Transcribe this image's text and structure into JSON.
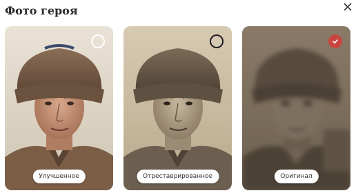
{
  "dialog": {
    "title": "Фото героя",
    "close_icon": "close-icon"
  },
  "photos": [
    {
      "label": "Улучшенное",
      "selected": false
    },
    {
      "label": "Отреставрированное",
      "selected": false
    },
    {
      "label": "Оригинал",
      "selected": true
    }
  ],
  "colors": {
    "accent": "#c8463f",
    "title": "#2b2b2b"
  }
}
